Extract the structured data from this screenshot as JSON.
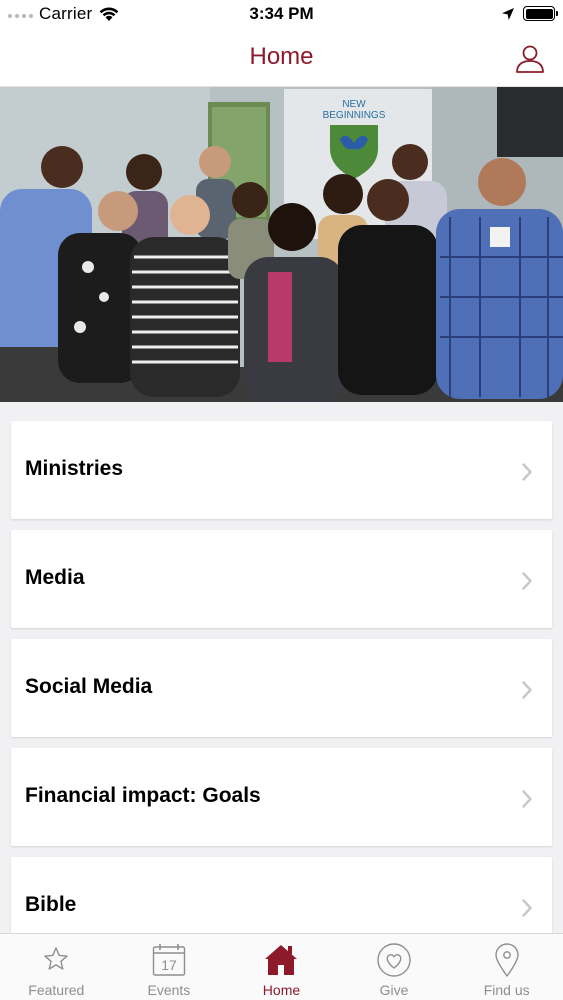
{
  "status_bar": {
    "carrier": "Carrier",
    "time": "3:34 PM",
    "battery_level": 1.0
  },
  "nav": {
    "title": "Home",
    "profile_icon": "person-icon"
  },
  "hero": {
    "alt_icon": "group-photo",
    "banner_text_line1": "NEW",
    "banner_text_line2": "BEGINNINGS"
  },
  "list": {
    "items": [
      {
        "label": "Ministries"
      },
      {
        "label": "Media"
      },
      {
        "label": "Social Media"
      },
      {
        "label": "Financial impact: Goals"
      },
      {
        "label": "Bible"
      }
    ]
  },
  "tabs": {
    "items": [
      {
        "label": "Featured",
        "icon": "star-icon",
        "active": false
      },
      {
        "label": "Events",
        "icon": "calendar-icon",
        "calendar_day": "17",
        "active": false
      },
      {
        "label": "Home",
        "icon": "home-icon",
        "active": true
      },
      {
        "label": "Give",
        "icon": "heart-icon",
        "active": false
      },
      {
        "label": "Find us",
        "icon": "location-pin-icon",
        "active": false
      }
    ]
  },
  "colors": {
    "accent": "#8d1a2b",
    "inactive": "#8e8e93",
    "background": "#f1f1f3"
  }
}
